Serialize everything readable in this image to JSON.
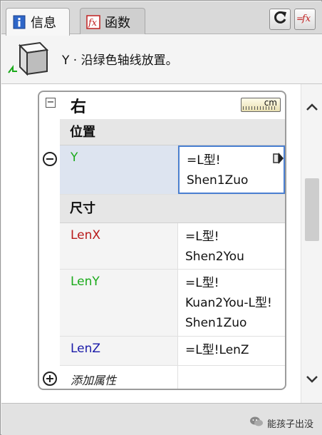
{
  "tabs": [
    {
      "label": "信息",
      "icon": "info-icon",
      "active": true
    },
    {
      "label": "函数",
      "icon": "function-icon",
      "active": false
    }
  ],
  "toolbar": {
    "refresh_icon": "refresh-icon",
    "formula_icon": "formula-toggle-icon"
  },
  "header": {
    "description": "Y · 沿绿色轴线放置。",
    "icon": "component-cube-icon"
  },
  "panel": {
    "title": "右",
    "unit_label": "cm",
    "sections": {
      "position": "位置",
      "size": "尺寸"
    },
    "rows": {
      "y": {
        "name": "Y",
        "value_line1": "=L型!",
        "value_line2": "Shen1Zuo",
        "name_color": "#1aaa1a"
      },
      "lenx": {
        "name": "LenX",
        "value_line1": "=L型!",
        "value_line2": "Shen2You",
        "name_color": "#b81a1a"
      },
      "leny": {
        "name": "LenY",
        "value_line1": "=L型!",
        "value_line2": "Kuan2You-L型!",
        "value_line3": "Shen1Zuo",
        "name_color": "#1aaa1a"
      },
      "lenz": {
        "name": "LenZ",
        "value_line1": "=L型!LenZ",
        "name_color": "#1a1aa8"
      }
    },
    "add_attribute": "添加属性"
  },
  "footer": {
    "watermark": "能孩子出没",
    "watermark_icon": "wechat-icon"
  }
}
